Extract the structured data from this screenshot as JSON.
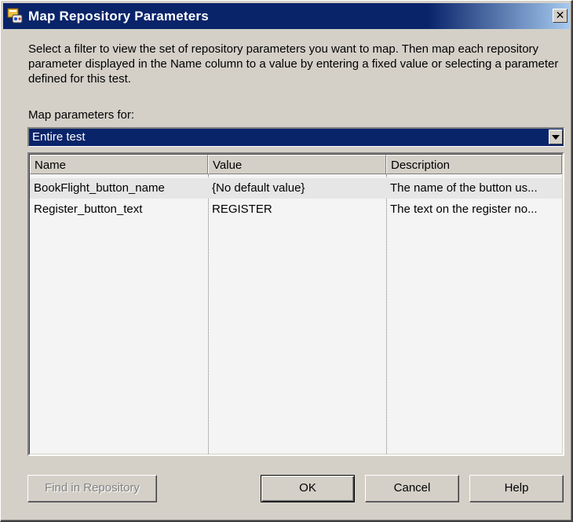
{
  "window": {
    "title": "Map Repository Parameters",
    "close_glyph": "✕"
  },
  "instructions": "Select a filter to view the set of repository parameters you want to map.  Then map each repository parameter displayed in the Name column to a value by entering a fixed value or selecting a parameter defined for this test.",
  "filter": {
    "label": "Map parameters for:",
    "selected": "Entire test"
  },
  "table": {
    "columns": [
      "Name",
      "Value",
      "Description"
    ],
    "rows": [
      [
        "BookFlight_button_name",
        "{No default value}",
        "The name of the button us..."
      ],
      [
        "Register_button_text",
        "REGISTER",
        "The text on the register no..."
      ]
    ]
  },
  "buttons": {
    "find": "Find in Repository",
    "ok": "OK",
    "cancel": "Cancel",
    "help": "Help"
  },
  "colors": {
    "titlebar": "#0a246a",
    "face": "#d4d0c8",
    "selection": "#0a246a"
  }
}
